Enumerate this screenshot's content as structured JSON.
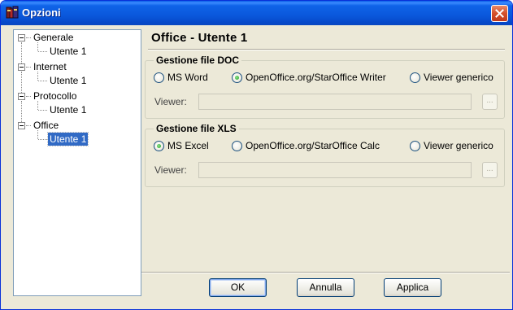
{
  "window": {
    "title": "Opzioni",
    "icon": "app-icon",
    "close_icon": "close-icon"
  },
  "tree": {
    "nodes": [
      {
        "label": "Generale",
        "expanded": true,
        "children": [
          {
            "label": "Utente 1"
          }
        ]
      },
      {
        "label": "Internet",
        "expanded": true,
        "children": [
          {
            "label": "Utente 1"
          }
        ]
      },
      {
        "label": "Protocollo",
        "expanded": true,
        "children": [
          {
            "label": "Utente 1"
          }
        ]
      },
      {
        "label": "Office",
        "expanded": true,
        "children": [
          {
            "label": "Utente 1",
            "selected": true
          }
        ]
      }
    ]
  },
  "page": {
    "title": "Office - Utente 1",
    "groups": [
      {
        "legend": "Gestione file DOC",
        "options": [
          "MS Word",
          "OpenOffice.org/StarOffice Writer",
          "Viewer generico"
        ],
        "selected_index": 1,
        "viewer_label": "Viewer:",
        "viewer_value": "",
        "browse_label": "..."
      },
      {
        "legend": "Gestione file XLS",
        "options": [
          "MS Excel",
          "OpenOffice.org/StarOffice Calc",
          "Viewer generico"
        ],
        "selected_index": 0,
        "viewer_label": "Viewer:",
        "viewer_value": "",
        "browse_label": "..."
      }
    ]
  },
  "buttons": {
    "ok": "OK",
    "cancel": "Annulla",
    "apply": "Applica"
  },
  "colors": {
    "titlebar": "#0a58dc",
    "selection": "#316ac5",
    "face": "#ece9d8",
    "close": "#d4502a"
  }
}
